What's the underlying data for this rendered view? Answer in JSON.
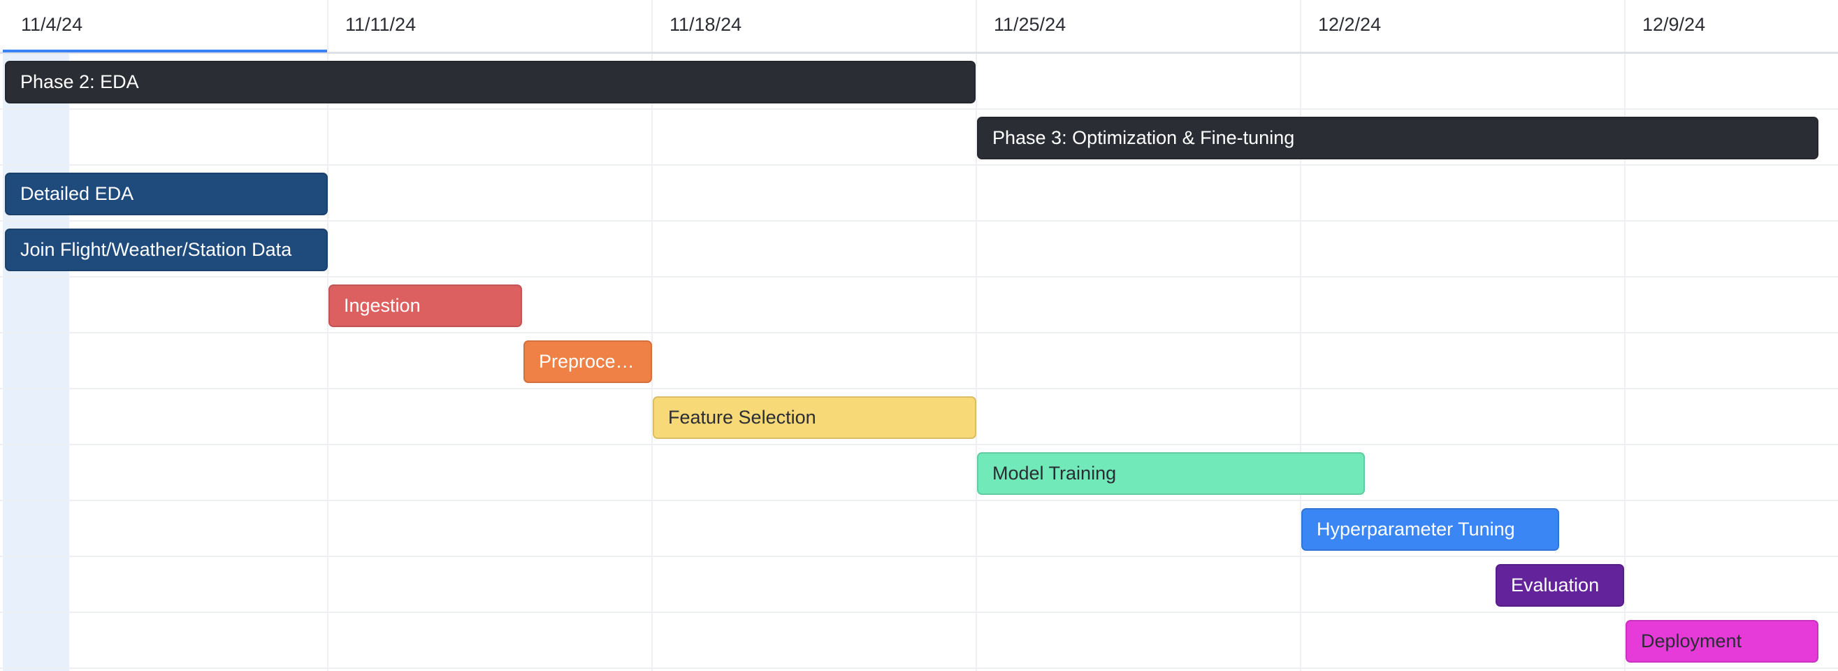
{
  "timeline": {
    "week_headers": [
      "11/4/24",
      "11/11/24",
      "11/18/24",
      "11/25/24",
      "12/2/24",
      "12/9/24"
    ],
    "tasks": [
      {
        "label": "Phase 2: EDA",
        "color": "#2b2d35",
        "text_color": "#ffffff"
      },
      {
        "label": "Phase 3: Optimization & Fine-tuning",
        "color": "#2b2d35",
        "text_color": "#ffffff"
      },
      {
        "label": "Detailed EDA",
        "color": "#1f4a7c",
        "text_color": "#ffffff"
      },
      {
        "label": "Join Flight/Weather/Station Data",
        "color": "#1f4a7c",
        "text_color": "#ffffff"
      },
      {
        "label": "Ingestion",
        "color": "#dc6060",
        "text_color": "#ffffff"
      },
      {
        "label": "Preprocessing",
        "color": "#ef8146",
        "text_color": "#ffffff"
      },
      {
        "label": "Feature Selection",
        "color": "#f8d978",
        "text_color": "#2a2d33"
      },
      {
        "label": "Model Training",
        "color": "#72e9b9",
        "text_color": "#2a2d33"
      },
      {
        "label": "Hyperparameter Tuning",
        "color": "#3b86f5",
        "text_color": "#ffffff"
      },
      {
        "label": "Evaluation",
        "color": "#63239a",
        "text_color": "#ffffff"
      },
      {
        "label": "Deployment",
        "color": "#e63bd9",
        "text_color": "#2a2d33"
      }
    ]
  }
}
